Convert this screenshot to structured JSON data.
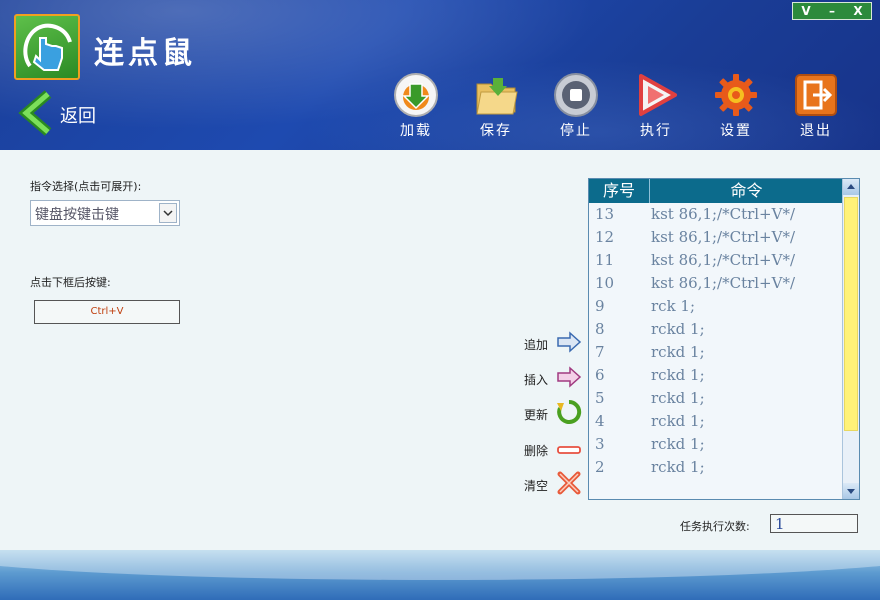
{
  "app": {
    "title": "连点鼠"
  },
  "window_controls": [
    "V",
    "–",
    "X"
  ],
  "nav": {
    "back_label": "返回"
  },
  "toolbar": {
    "items": [
      {
        "label": "加载",
        "icon": "load-icon"
      },
      {
        "label": "保存",
        "icon": "save-folder-icon"
      },
      {
        "label": "停止",
        "icon": "stop-icon"
      },
      {
        "label": "执行",
        "icon": "play-icon"
      },
      {
        "label": "设置",
        "icon": "gear-icon"
      },
      {
        "label": "退出",
        "icon": "exit-icon"
      }
    ]
  },
  "command_select": {
    "label": "指令选择(点击可展开):",
    "value": "键盘按键击键"
  },
  "key_capture": {
    "label": "点击下框后按键:",
    "value": "Ctrl+V"
  },
  "actions": {
    "append": "追加",
    "insert": "插入",
    "update": "更新",
    "delete": "删除",
    "clear": "清空"
  },
  "table": {
    "headers": [
      "序号",
      "命令"
    ],
    "rows": [
      [
        "13",
        "kst 86,1;/*Ctrl+V*/"
      ],
      [
        "12",
        "kst 86,1;/*Ctrl+V*/"
      ],
      [
        "11",
        "kst 86,1;/*Ctrl+V*/"
      ],
      [
        "10",
        "kst 86,1;/*Ctrl+V*/"
      ],
      [
        "9",
        "rck 1;"
      ],
      [
        "8",
        "rckd 1;"
      ],
      [
        "7",
        "rckd 1;"
      ],
      [
        "6",
        "rckd 1;"
      ],
      [
        "5",
        "rckd 1;"
      ],
      [
        "4",
        "rckd 1;"
      ],
      [
        "3",
        "rckd 1;"
      ],
      [
        "2",
        "rckd 1;"
      ]
    ]
  },
  "repeat": {
    "label": "任务执行次数:",
    "value": "1"
  },
  "colors": {
    "header_blue": "#1e4ab0",
    "table_header": "#0c6b8c",
    "scroll_thumb": "#fff278",
    "accent_orange": "#f0a020"
  }
}
